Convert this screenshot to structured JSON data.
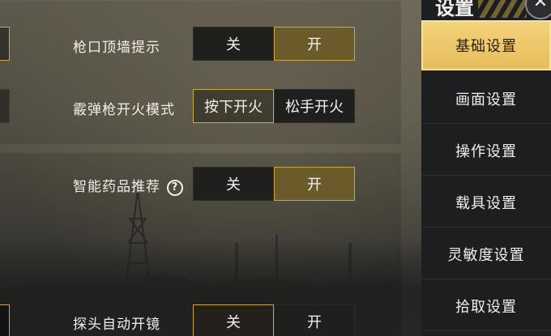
{
  "settings": {
    "rows": [
      {
        "label": "枪口顶墙提示",
        "options": [
          "关",
          "开"
        ],
        "selected": 1,
        "help": false
      },
      {
        "label": "霰弹枪开火模式",
        "options": [
          "按下开火",
          "松手开火"
        ],
        "selected": 0,
        "help": false
      },
      {
        "label": "智能药品推荐",
        "options": [
          "关",
          "开"
        ],
        "selected": 1,
        "help": true
      },
      {
        "label": "探头自动开镜",
        "options": [
          "关",
          "开"
        ],
        "selected": 0,
        "help": false
      }
    ],
    "help_glyph": "?"
  },
  "sidebar": {
    "title": "设置",
    "close_glyph": "✕",
    "tabs": [
      {
        "label": "基础设置",
        "active": true
      },
      {
        "label": "画面设置",
        "active": false
      },
      {
        "label": "操作设置",
        "active": false
      },
      {
        "label": "载具设置",
        "active": false
      },
      {
        "label": "灵敏度设置",
        "active": false
      },
      {
        "label": "拾取设置",
        "active": false
      }
    ]
  },
  "colors": {
    "accent": "#c9a646",
    "active_tab": "#e9c262",
    "sidebar_bg": "#1d1e1f"
  },
  "icons": {
    "close": "close-icon",
    "help": "help-icon",
    "tower": "radio-tower-icon"
  }
}
